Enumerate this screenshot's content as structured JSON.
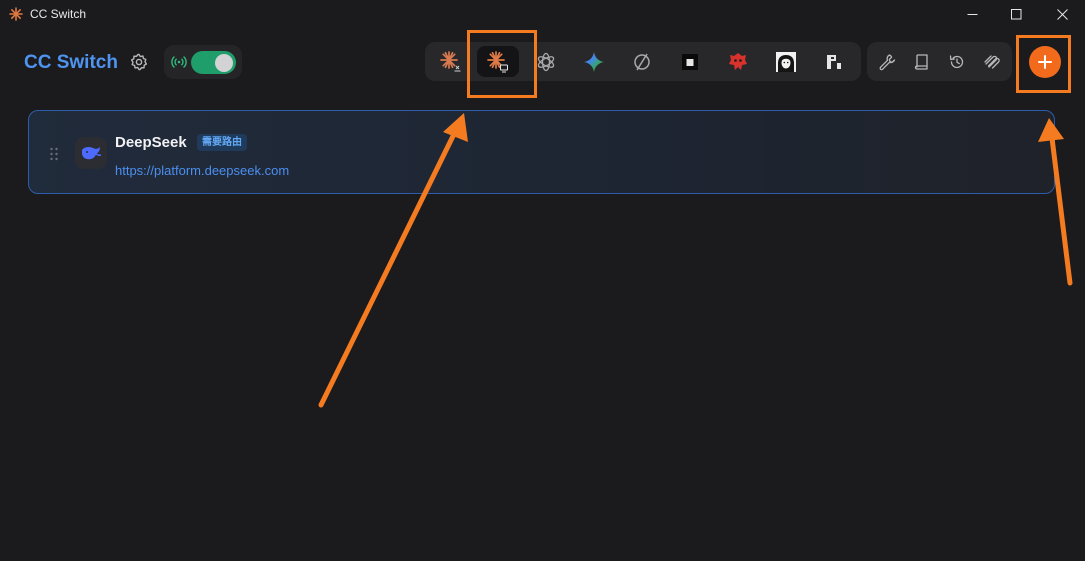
{
  "window": {
    "title": "CC Switch",
    "controls": [
      "minimize-icon",
      "maximize-icon",
      "close-icon"
    ]
  },
  "header": {
    "app_title": "CC Switch",
    "settings_icon": "gear-icon",
    "proxy": {
      "icon": "broadcast-icon",
      "enabled": true,
      "accent": "#1f9e6b"
    },
    "app_switcher": [
      {
        "name": "claude",
        "icon": "claude-spark-icon",
        "active": false
      },
      {
        "name": "claude-desktop",
        "icon": "claude-desktop-icon",
        "active": true
      },
      {
        "name": "openai",
        "icon": "openai-icon",
        "active": false
      },
      {
        "name": "gemini",
        "icon": "gemini-sparkle-icon",
        "active": false
      },
      {
        "name": "opencode",
        "icon": "opencode-icon",
        "active": false
      },
      {
        "name": "black-square",
        "icon": "square-icon",
        "active": false
      },
      {
        "name": "red-mascot",
        "icon": "red-mascot-icon",
        "active": false
      },
      {
        "name": "portrait",
        "icon": "portrait-icon",
        "active": false
      },
      {
        "name": "pixel",
        "icon": "pixel-logo-icon",
        "active": false
      }
    ],
    "tools": [
      {
        "name": "tools",
        "icon": "wrench-icon"
      },
      {
        "name": "docs",
        "icon": "book-icon"
      },
      {
        "name": "history",
        "icon": "history-icon"
      },
      {
        "name": "usage",
        "icon": "pipes-icon"
      }
    ],
    "add_button": {
      "icon": "plus-icon",
      "color": "#f26b1d"
    }
  },
  "providers": [
    {
      "name": "DeepSeek",
      "badge": "需要路由",
      "url": "https://platform.deepseek.com",
      "logo_icon": "deepseek-whale-icon"
    }
  ],
  "annotations": {
    "color": "#f47b20"
  }
}
